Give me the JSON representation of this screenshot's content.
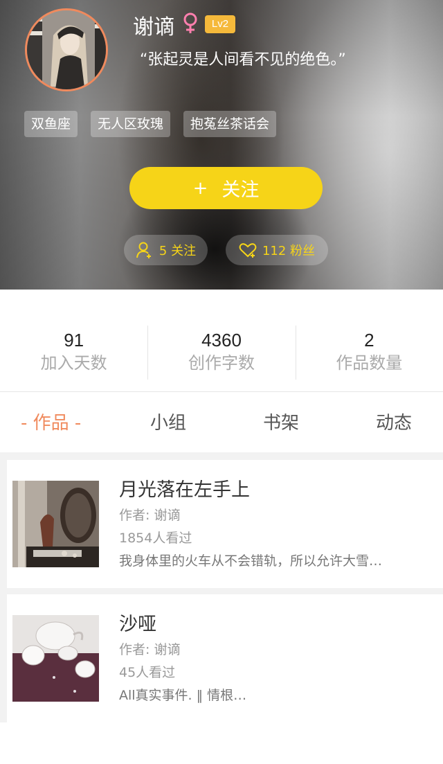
{
  "profile": {
    "name": "谢谪",
    "gender": "female",
    "level": "Lv2",
    "signature": "“张起灵是人间看不见的绝色。”",
    "tags": [
      "双鱼座",
      "无人区玫瑰",
      "抱菟丝茶话会"
    ],
    "follow_label": "关注",
    "follow_plus": "+",
    "following_text": "5 关注",
    "fans_text": "112 粉丝"
  },
  "stats": [
    {
      "value": "91",
      "label": "加入天数"
    },
    {
      "value": "4360",
      "label": "创作字数"
    },
    {
      "value": "2",
      "label": "作品数量"
    }
  ],
  "tabs": {
    "works": "- 作品 -",
    "group": "小组",
    "shelf": "书架",
    "moments": "动态"
  },
  "works": [
    {
      "title": "月光落在左手上",
      "author": "作者: 谢谪",
      "views": "1854人看过",
      "description": "我身体里的火车从不会错轨，所以允许大雪…"
    },
    {
      "title": "沙哑",
      "author": "作者: 谢谪",
      "views": "45人看过",
      "description": "All真实事件. ‖ 情根…"
    }
  ],
  "colors": {
    "accent": "#f08a5d",
    "follow_button": "#f6d418",
    "level_badge": "#f5b93b"
  },
  "icons": {
    "gender": "female-icon",
    "following": "user-plus-icon",
    "fans": "heart-icon"
  }
}
